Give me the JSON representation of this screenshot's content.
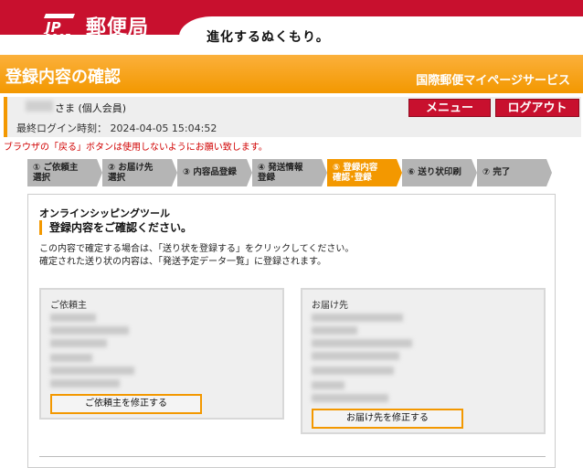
{
  "header": {
    "logo_mark": "JP",
    "logo_post": "POST",
    "logo_text": "郵便局",
    "tagline": "進化するぬくもり。"
  },
  "titlebar": {
    "title": "登録内容の確認",
    "service_name": "国際郵便マイページサービス"
  },
  "user": {
    "name_suffix": "さま (個人会員)",
    "last_login": "最終ログイン時刻：  2024-04-05 15:04:52"
  },
  "buttons": {
    "menu": "メニュー",
    "logout": "ログアウト"
  },
  "warning": "ブラウザの「戻る」ボタンは使用しないようにお願い致します。",
  "steps": [
    {
      "line1": "① ご依頼主",
      "line2": "選択",
      "active": false
    },
    {
      "line1": "② お届け先",
      "line2": "選択",
      "active": false
    },
    {
      "line1": "③ 内容品登録",
      "line2": "",
      "active": false
    },
    {
      "line1": "④ 発送情報",
      "line2": "登録",
      "active": false
    },
    {
      "line1": "⑤ 登録内容",
      "line2": "確認･登録",
      "active": true
    },
    {
      "line1": "⑥ 送り状印刷",
      "line2": "",
      "active": false
    },
    {
      "line1": "⑦ 完了",
      "line2": "",
      "active": false
    }
  ],
  "main": {
    "tool_title": "オンラインシッピングツール",
    "heading": "登録内容をご確認ください。",
    "desc1": "この内容で確定する場合は、「送り状を登録する」をクリックしてください。",
    "desc2": "確定された送り状の内容は、「発送予定データ一覧」に登録されます。",
    "sender": {
      "label": "ご依頼主",
      "edit_button": "ご依頼主を修正する"
    },
    "recipient": {
      "label": "お届け先",
      "edit_button": "お届け先を修正する"
    }
  },
  "colors": {
    "brand_red": "#c8102e",
    "accent_orange": "#f39800",
    "warning_red": "#d00000"
  }
}
